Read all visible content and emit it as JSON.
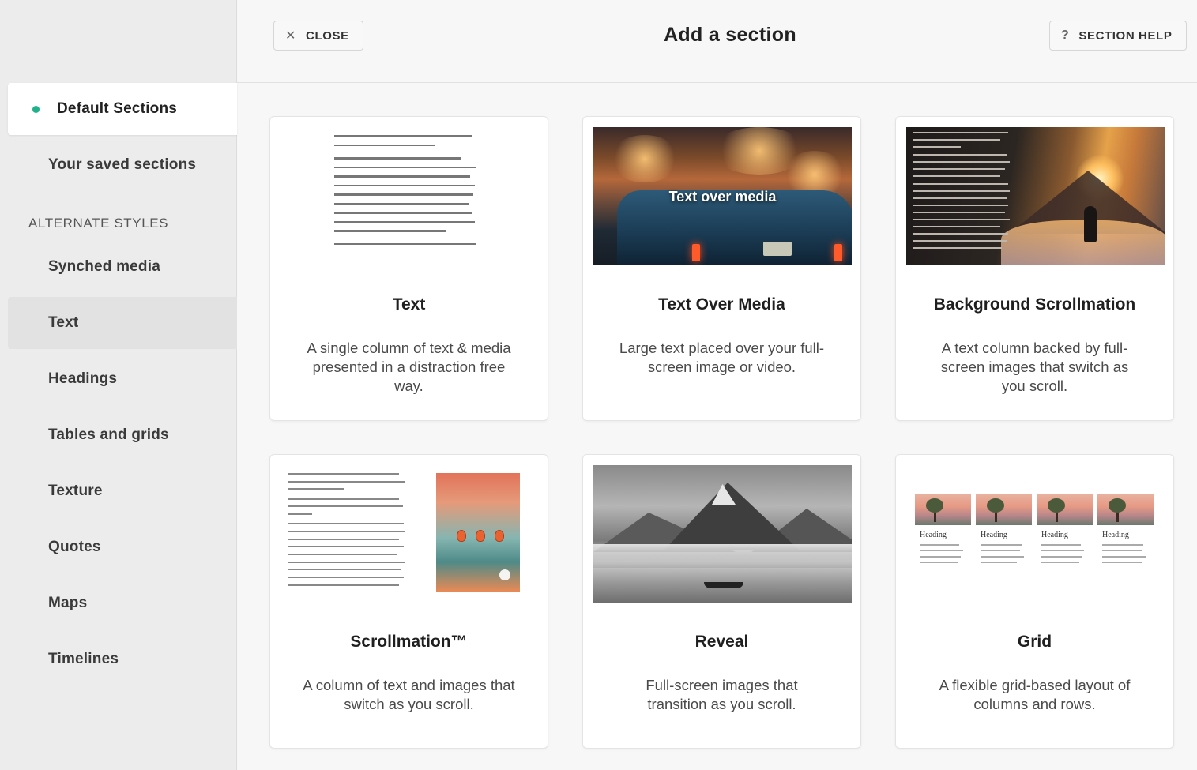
{
  "header": {
    "close_label": "CLOSE",
    "title": "Add a section",
    "help_label": "SECTION HELP",
    "close_icon": "close-icon",
    "help_icon": "question-icon"
  },
  "sidebar": {
    "default_sections": "Default Sections",
    "saved_sections": "Your saved sections",
    "alternate_heading": "ALTERNATE STYLES",
    "items": [
      "Synched media",
      "Text",
      "Headings",
      "Tables and grids",
      "Texture",
      "Quotes",
      "Maps",
      "Timelines"
    ],
    "selected": "Text",
    "accent": "#1fb28a"
  },
  "cards": [
    {
      "title": "Text",
      "desc": "A single column of text & media presented in a distraction free way."
    },
    {
      "title": "Text Over Media",
      "desc": "Large text placed over your full-screen image or video.",
      "overlay": "Text over media"
    },
    {
      "title": "Background Scrollmation",
      "desc": "A text column backed by full-screen images that switch as you scroll."
    },
    {
      "title": "Scrollmation™",
      "desc": "A column of text and images that switch as you scroll."
    },
    {
      "title": "Reveal",
      "desc": "Full-screen images that transition as you scroll."
    },
    {
      "title": "Grid",
      "desc": "A flexible grid-based layout of columns and rows.",
      "grid_heading": "Heading"
    }
  ]
}
